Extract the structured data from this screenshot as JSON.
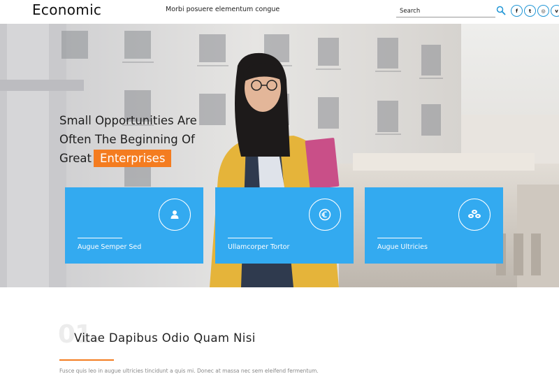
{
  "header": {
    "logo": "Economic",
    "tagline": "Morbi posuere elementum congue",
    "search_placeholder": "Search",
    "social": [
      {
        "icon": "facebook-icon",
        "glyph": "f"
      },
      {
        "icon": "twitter-icon",
        "glyph": "t"
      },
      {
        "icon": "dribbble-icon",
        "glyph": "◎"
      },
      {
        "icon": "vimeo-icon",
        "glyph": "v"
      }
    ]
  },
  "hero": {
    "headline_lines": [
      "Small Opportunities Are",
      "Often The Beginning Of",
      "Great"
    ],
    "headline_highlight": "Enterprises",
    "features": [
      {
        "label": "Augue Semper Sed",
        "icon": "user-icon"
      },
      {
        "label": "Ullamcorper Tortor",
        "icon": "euro-icon"
      },
      {
        "label": "Augue Ultricies",
        "icon": "coins-icon"
      }
    ]
  },
  "section": {
    "number": "01.",
    "title": "Vitae Dapibus Odio Quam Nisi",
    "text": "Fusce quis leo in augue ultricies tincidunt a quis mi. Donec at massa nec sem eleifend fermentum."
  },
  "colors": {
    "accent_orange": "#f47c20",
    "feature_blue": "#33aaf0",
    "social_blue": "#2196d6"
  }
}
